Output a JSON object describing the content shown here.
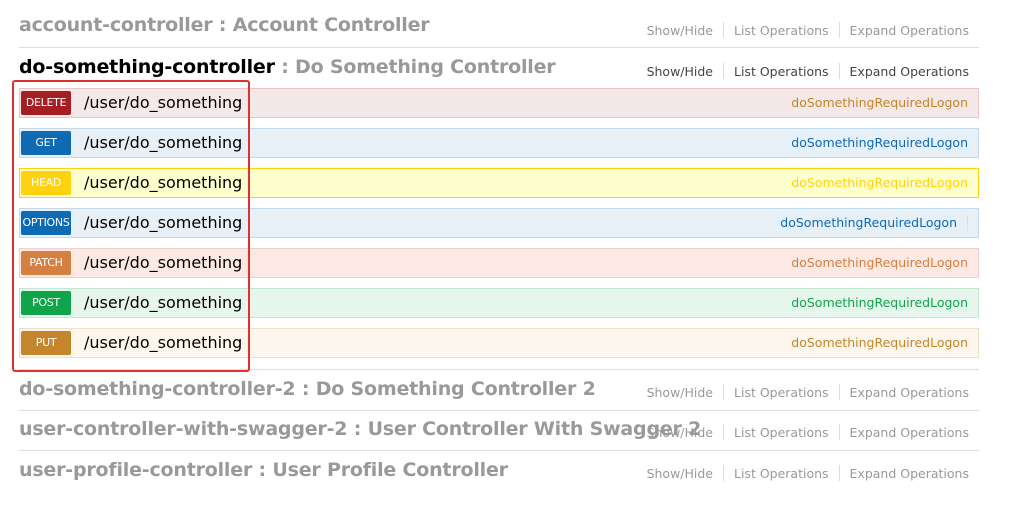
{
  "resources_top": [
    {
      "name": "account-controller",
      "description": "Account Controller"
    }
  ],
  "active_resource": {
    "name": "do-something-controller",
    "description": "Do Something Controller"
  },
  "resources_bottom": [
    {
      "name": "do-something-controller-2",
      "description": "Do Something Controller 2"
    },
    {
      "name": "user-controller-with-swagger-2",
      "description": "User Controller With Swagger 2"
    },
    {
      "name": "user-profile-controller",
      "description": "User Profile Controller"
    }
  ],
  "links": {
    "show_hide": "Show/Hide",
    "list_operations": "List Operations",
    "expand_operations": "Expand Operations"
  },
  "separator": ":",
  "operations": [
    {
      "method": "DELETE",
      "path": "/user/do_something",
      "summary": "doSomethingRequiredLogon",
      "color": "#a41e22",
      "bg": "#f5e8e8",
      "border": "#e8c6c7",
      "text": "#c5862b"
    },
    {
      "method": "GET",
      "path": "/user/do_something",
      "summary": "doSomethingRequiredLogon",
      "color": "#0f6ab4",
      "bg": "#e7f0f7",
      "border": "#c3d9ec",
      "text": "#0f6ab4"
    },
    {
      "method": "HEAD",
      "path": "/user/do_something",
      "summary": "doSomethingRequiredLogon",
      "color": "#ffd20f",
      "bg": "#fcffcd",
      "border": "#ffd20f",
      "text": "#ffd20f"
    },
    {
      "method": "OPTIONS",
      "path": "/user/do_something",
      "summary": "doSomethingRequiredLogon",
      "color": "#0f6ab4",
      "bg": "#e7f0f7",
      "border": "#c3d9ec",
      "text": "#0f6ab4"
    },
    {
      "method": "PATCH",
      "path": "/user/do_something",
      "summary": "doSomethingRequiredLogon",
      "color": "#d38042",
      "bg": "#fce9e3",
      "border": "#f0cecb",
      "text": "#d38042"
    },
    {
      "method": "POST",
      "path": "/user/do_something",
      "summary": "doSomethingRequiredLogon",
      "color": "#10a54a",
      "bg": "#e7f6ec",
      "border": "#c3e8d1",
      "text": "#10a54a"
    },
    {
      "method": "PUT",
      "path": "/user/do_something",
      "summary": "doSomethingRequiredLogon",
      "color": "#c5862b",
      "bg": "#fcf6ed",
      "border": "#f0e0ca",
      "text": "#c5862b"
    }
  ],
  "annotation_color": "#e03030"
}
